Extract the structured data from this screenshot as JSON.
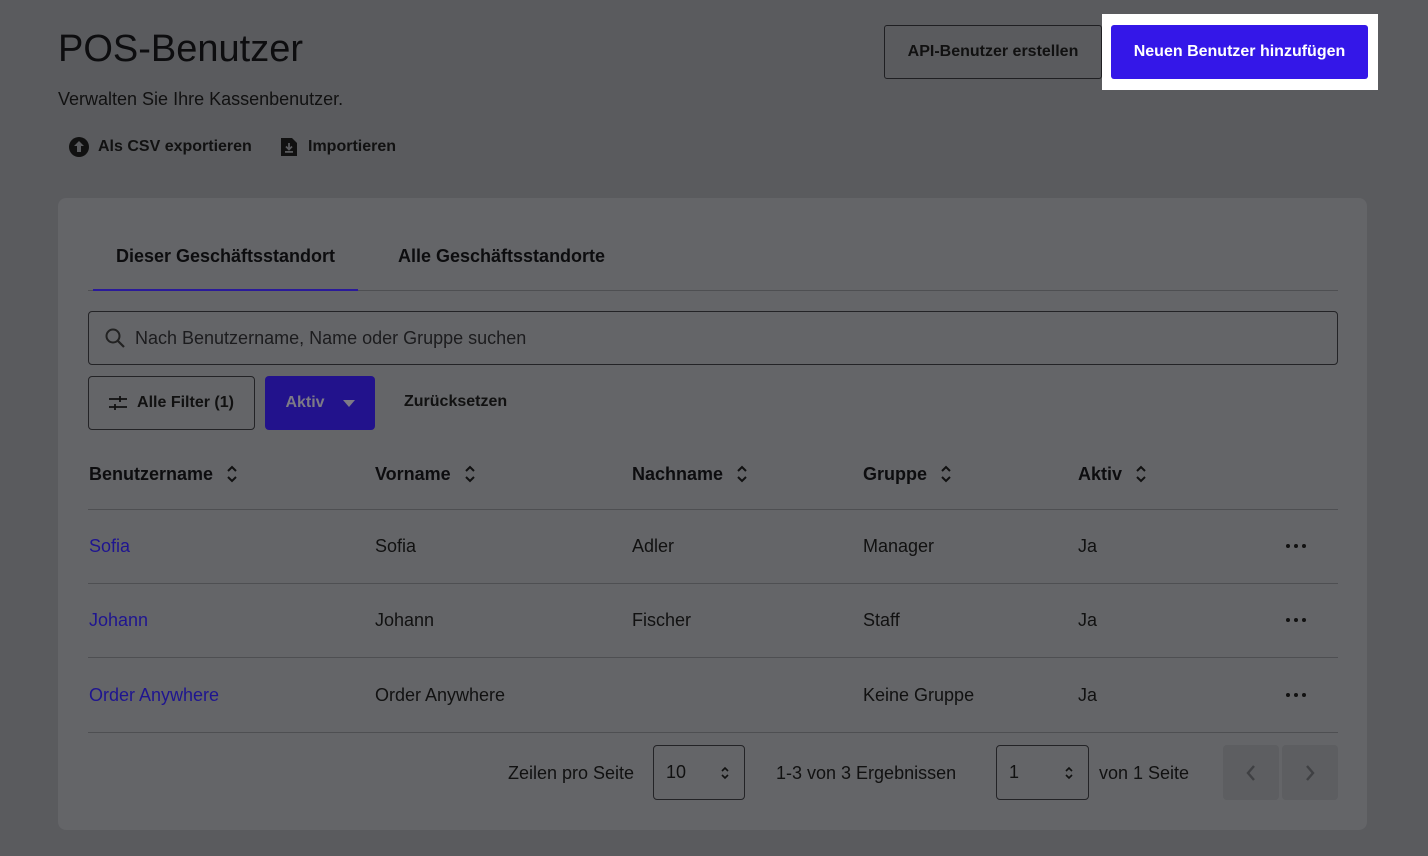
{
  "header": {
    "title": "POS-Benutzer",
    "subtitle": "Verwalten Sie Ihre Kassenbenutzer.",
    "api_button": "API-Benutzer erstellen",
    "new_button": "Neuen Benutzer hinzufügen"
  },
  "actions": {
    "export_label": "Als CSV exportieren",
    "import_label": "Importieren"
  },
  "tabs": [
    {
      "label": "Dieser Geschäftsstandort",
      "active": true
    },
    {
      "label": "Alle Geschäftsstandorte",
      "active": false
    }
  ],
  "search": {
    "placeholder": "Nach Benutzername, Name oder Gruppe suchen"
  },
  "filters": {
    "all_filters_label": "Alle Filter (1)",
    "status_label": "Aktiv",
    "reset_label": "Zurücksetzen"
  },
  "table": {
    "columns": [
      "Benutzername",
      "Vorname",
      "Nachname",
      "Gruppe",
      "Aktiv"
    ],
    "rows": [
      {
        "username": "Sofia",
        "first_name": "Sofia",
        "last_name": "Adler",
        "group": "Manager",
        "active": "Ja"
      },
      {
        "username": "Johann",
        "first_name": "Johann",
        "last_name": "Fischer",
        "group": "Staff",
        "active": "Ja"
      },
      {
        "username": "Order Anywhere",
        "first_name": "Order Anywhere",
        "last_name": "",
        "group": "Keine Gruppe",
        "active": "Ja"
      }
    ]
  },
  "pagination": {
    "rows_per_page_label": "Zeilen pro Seite",
    "rows_per_page": "10",
    "results_text": "1-3 von 3 Ergebnissen",
    "current_page": "1",
    "pages_text": "von 1 Seite"
  },
  "colors": {
    "primary": "#3417e8",
    "link": "#1f1590",
    "overlay_bg": "#5a5b5e"
  }
}
